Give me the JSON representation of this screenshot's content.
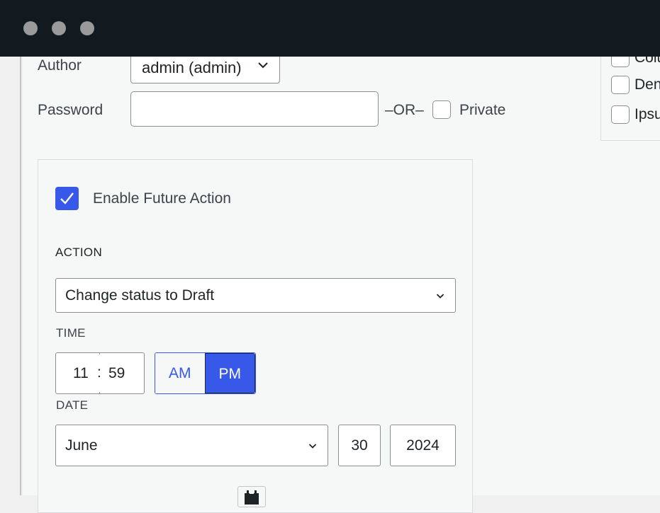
{
  "window": {
    "controls": [
      "close",
      "minimize",
      "maximize"
    ]
  },
  "author": {
    "label": "Author",
    "selected": "admin (admin)"
  },
  "password": {
    "label": "Password",
    "value": "",
    "or_text": "–OR–",
    "private_label": "Private",
    "private_checked": false
  },
  "categories": {
    "items": [
      {
        "label": "Colu",
        "checked": false
      },
      {
        "label": "Den",
        "checked": false
      },
      {
        "label": "Ipsu",
        "checked": false
      }
    ]
  },
  "future_action": {
    "enable_label": "Enable Future Action",
    "enabled": true,
    "action_label": "ACTION",
    "action_selected": "Change status to Draft",
    "time_label": "TIME",
    "hour": "11",
    "colon": ":",
    "minute": "59",
    "am_label": "AM",
    "pm_label": "PM",
    "meridiem_selected": "PM",
    "date_label": "DATE",
    "month_selected": "June",
    "day": "30",
    "year": "2024"
  },
  "colors": {
    "accent": "#3858e9",
    "titlebar": "#121a20",
    "background": "#f6f7f7"
  }
}
